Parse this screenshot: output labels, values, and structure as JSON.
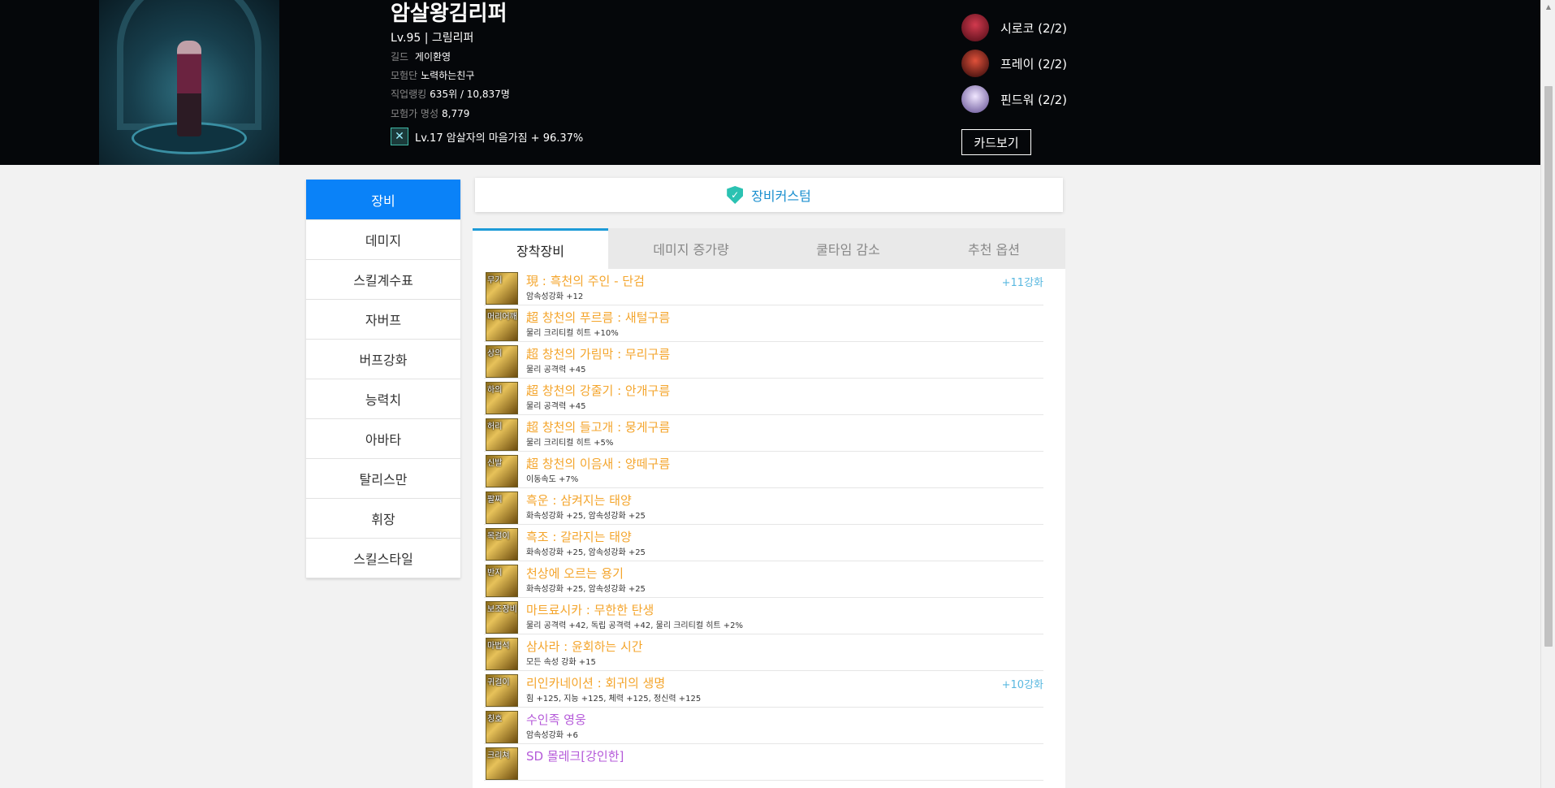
{
  "character": {
    "name": "암살왕김리퍼",
    "level_class": "Lv.95 | 그림리퍼",
    "guild_label": "길드",
    "guild": "게이환영",
    "adventure_label": "모험단",
    "adventure": "노력하는친구",
    "rank_label": "직업랭킹",
    "rank": "635위 / 10,837명",
    "fame_label": "모험가 명성",
    "fame": "8,779",
    "buff": "Lv.17 암살자의 마음가짐 + 96.37%",
    "buff_icon": "crossed-blades-icon"
  },
  "creatures": [
    {
      "label": "시로코 (2/2)",
      "color": "#8a1c2a"
    },
    {
      "label": "프레이 (2/2)",
      "color": "#7a1014"
    },
    {
      "label": "핀드워 (2/2)",
      "color": "#b8a6d8"
    }
  ],
  "card_button": "카드보기",
  "sidebar": {
    "items": [
      "장비",
      "데미지",
      "스킬계수표",
      "자버프",
      "버프강화",
      "능력치",
      "아바타",
      "탈리스만",
      "휘장",
      "스킬스타일"
    ]
  },
  "custom_bar": {
    "label": "장비커스텀",
    "icon": "shield-check-icon"
  },
  "tabs": [
    "장착장비",
    "데미지 증가량",
    "쿨타임 감소",
    "추천 옵션"
  ],
  "equipment": [
    {
      "slot": "무기",
      "name": "現 : 흑천의 주인 - 단검",
      "option": "암속성강화 +12",
      "enhance": "+11강화",
      "color": "orange"
    },
    {
      "slot": "머리어깨",
      "name": "超 창천의 푸르름 : 새털구름",
      "option": "물리 크리티컬 히트 +10%",
      "enhance": "",
      "color": "orange"
    },
    {
      "slot": "상의",
      "name": "超 창천의 가림막 : 무리구름",
      "option": "물리 공격력 +45",
      "enhance": "",
      "color": "orange"
    },
    {
      "slot": "하의",
      "name": "超 창천의 강줄기 : 안개구름",
      "option": "물리 공격력 +45",
      "enhance": "",
      "color": "orange"
    },
    {
      "slot": "허리",
      "name": "超 창천의 들고개 : 뭉게구름",
      "option": "물리 크리티컬 히트 +5%",
      "enhance": "",
      "color": "orange"
    },
    {
      "slot": "신발",
      "name": "超 창천의 이음새 : 양떼구름",
      "option": "이동속도 +7%",
      "enhance": "",
      "color": "orange"
    },
    {
      "slot": "팔찌",
      "name": "흑운 : 삼켜지는 태양",
      "option": "화속성강화 +25, 암속성강화 +25",
      "enhance": "",
      "color": "orange"
    },
    {
      "slot": "목걸이",
      "name": "흑조 : 갈라지는 태양",
      "option": "화속성강화 +25, 암속성강화 +25",
      "enhance": "",
      "color": "orange"
    },
    {
      "slot": "반지",
      "name": "천상에 오르는 용기",
      "option": "화속성강화 +25, 암속성강화 +25",
      "enhance": "",
      "color": "orange"
    },
    {
      "slot": "보조장비",
      "name": "마트료시카 : 무한한 탄생",
      "option": "물리 공격력 +42, 독립 공격력 +42, 물리 크리티컬 히트 +2%",
      "enhance": "",
      "color": "orange"
    },
    {
      "slot": "마법석",
      "name": "삼사라 : 윤회하는 시간",
      "option": "모든 속성 강화 +15",
      "enhance": "",
      "color": "orange"
    },
    {
      "slot": "귀걸이",
      "name": "리인카네이션 : 회귀의 생명",
      "option": "힘 +125, 지능 +125, 체력 +125, 정신력 +125",
      "enhance": "+10강화",
      "color": "orange"
    },
    {
      "slot": "칭호",
      "name": "수인족 영웅",
      "option": "암속성강화 +6",
      "enhance": "",
      "color": "purple"
    },
    {
      "slot": "크리쳐",
      "name": "SD 몰레크[강인한]",
      "option": "",
      "enhance": "",
      "color": "purple"
    }
  ]
}
